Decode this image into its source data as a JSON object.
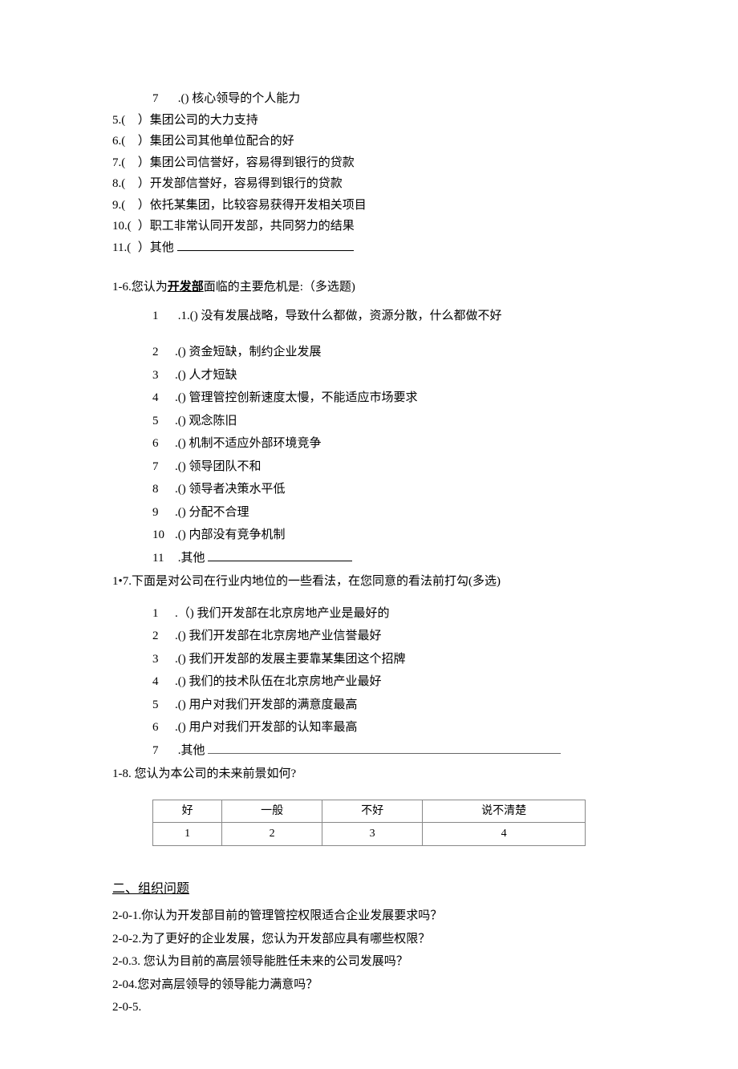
{
  "q1_5": {
    "items": [
      {
        "n": "7",
        "t": ".() 核心领导的个人能力"
      },
      {
        "n": "5.(",
        "t": "）集团公司的大力支持"
      },
      {
        "n": "6.(",
        "t": "）集团公司其他单位配合的好"
      },
      {
        "n": "7.(",
        "t": "）集团公司信誉好，容易得到银行的贷款"
      },
      {
        "n": "8.(",
        "t": "）开发部信誉好，容易得到银行的贷款"
      },
      {
        "n": "9.(",
        "t": "）依托某集团，比较容易获得开发相关项目"
      },
      {
        "n": "10.(",
        "t": "）职工非常认同开发部，共同努力的结果"
      },
      {
        "n": "11.(",
        "t": "）其他 "
      }
    ]
  },
  "q1_6": {
    "title_pre": "1-6.您认为",
    "title_bold": "开发部",
    "title_post": "面临的主要危机是:（多选题)",
    "first": {
      "n": "1",
      "t": ".1.() 没有发展战略，导致什么都做，资源分散，什么都做不好"
    },
    "items": [
      {
        "n": "2",
        "t": ".() 资金短缺，制约企业发展"
      },
      {
        "n": "3",
        "t": ".() 人才短缺"
      },
      {
        "n": "4",
        "t": ".() 管理管控创新速度太慢，不能适应市场要求"
      },
      {
        "n": "5",
        "t": ".() 观念陈旧"
      },
      {
        "n": "6",
        "t": ".() 机制不适应外部环境竞争"
      },
      {
        "n": "7",
        "t": ".() 领导团队不和"
      },
      {
        "n": "8",
        "t": ".() 领导者决策水平低"
      },
      {
        "n": "9",
        "t": ".() 分配不合理"
      },
      {
        "n": "10",
        "t": ".() 内部没有竞争机制"
      },
      {
        "n": "11",
        "t": ".其他 "
      }
    ]
  },
  "q1_7": {
    "title": "1•7.下面是对公司在行业内地位的一些看法，在您同意的看法前打勾(多选)",
    "items": [
      {
        "n": "1",
        "t": ".（) 我们开发部在北京房地产业是最好的"
      },
      {
        "n": "2",
        "t": ".() 我们开发部在北京房地产业信誉最好"
      },
      {
        "n": "3",
        "t": ".() 我们开发部的发展主要靠某集团这个招牌"
      },
      {
        "n": "4",
        "t": ".() 我们的技术队伍在北京房地产业最好"
      },
      {
        "n": "5",
        "t": ".() 用户对我们开发部的满意度最高"
      },
      {
        "n": "6",
        "t": ".() 用户对我们开发部的认知率最高"
      },
      {
        "n": "7",
        "t": ".其他 "
      }
    ]
  },
  "q1_8": {
    "title": "1-8. 您认为本公司的未来前景如何?",
    "headers": [
      "好",
      "一般",
      "不好",
      "说不清楚"
    ],
    "values": [
      "1",
      "2",
      "3",
      "4"
    ]
  },
  "section2": {
    "header": "二、组织问题",
    "items": [
      "2-0-1.你认为开发部目前的管理管控权限适合企业发展要求吗？",
      "2-0-2.为了更好的企业发展，您认为开发部应具有哪些权限？",
      "2-0.3. 您认为目前的高层领导能胜任未来的公司发展吗？",
      "2-04.您对高层领导的领导能力满意吗？",
      "2-0-5."
    ]
  }
}
